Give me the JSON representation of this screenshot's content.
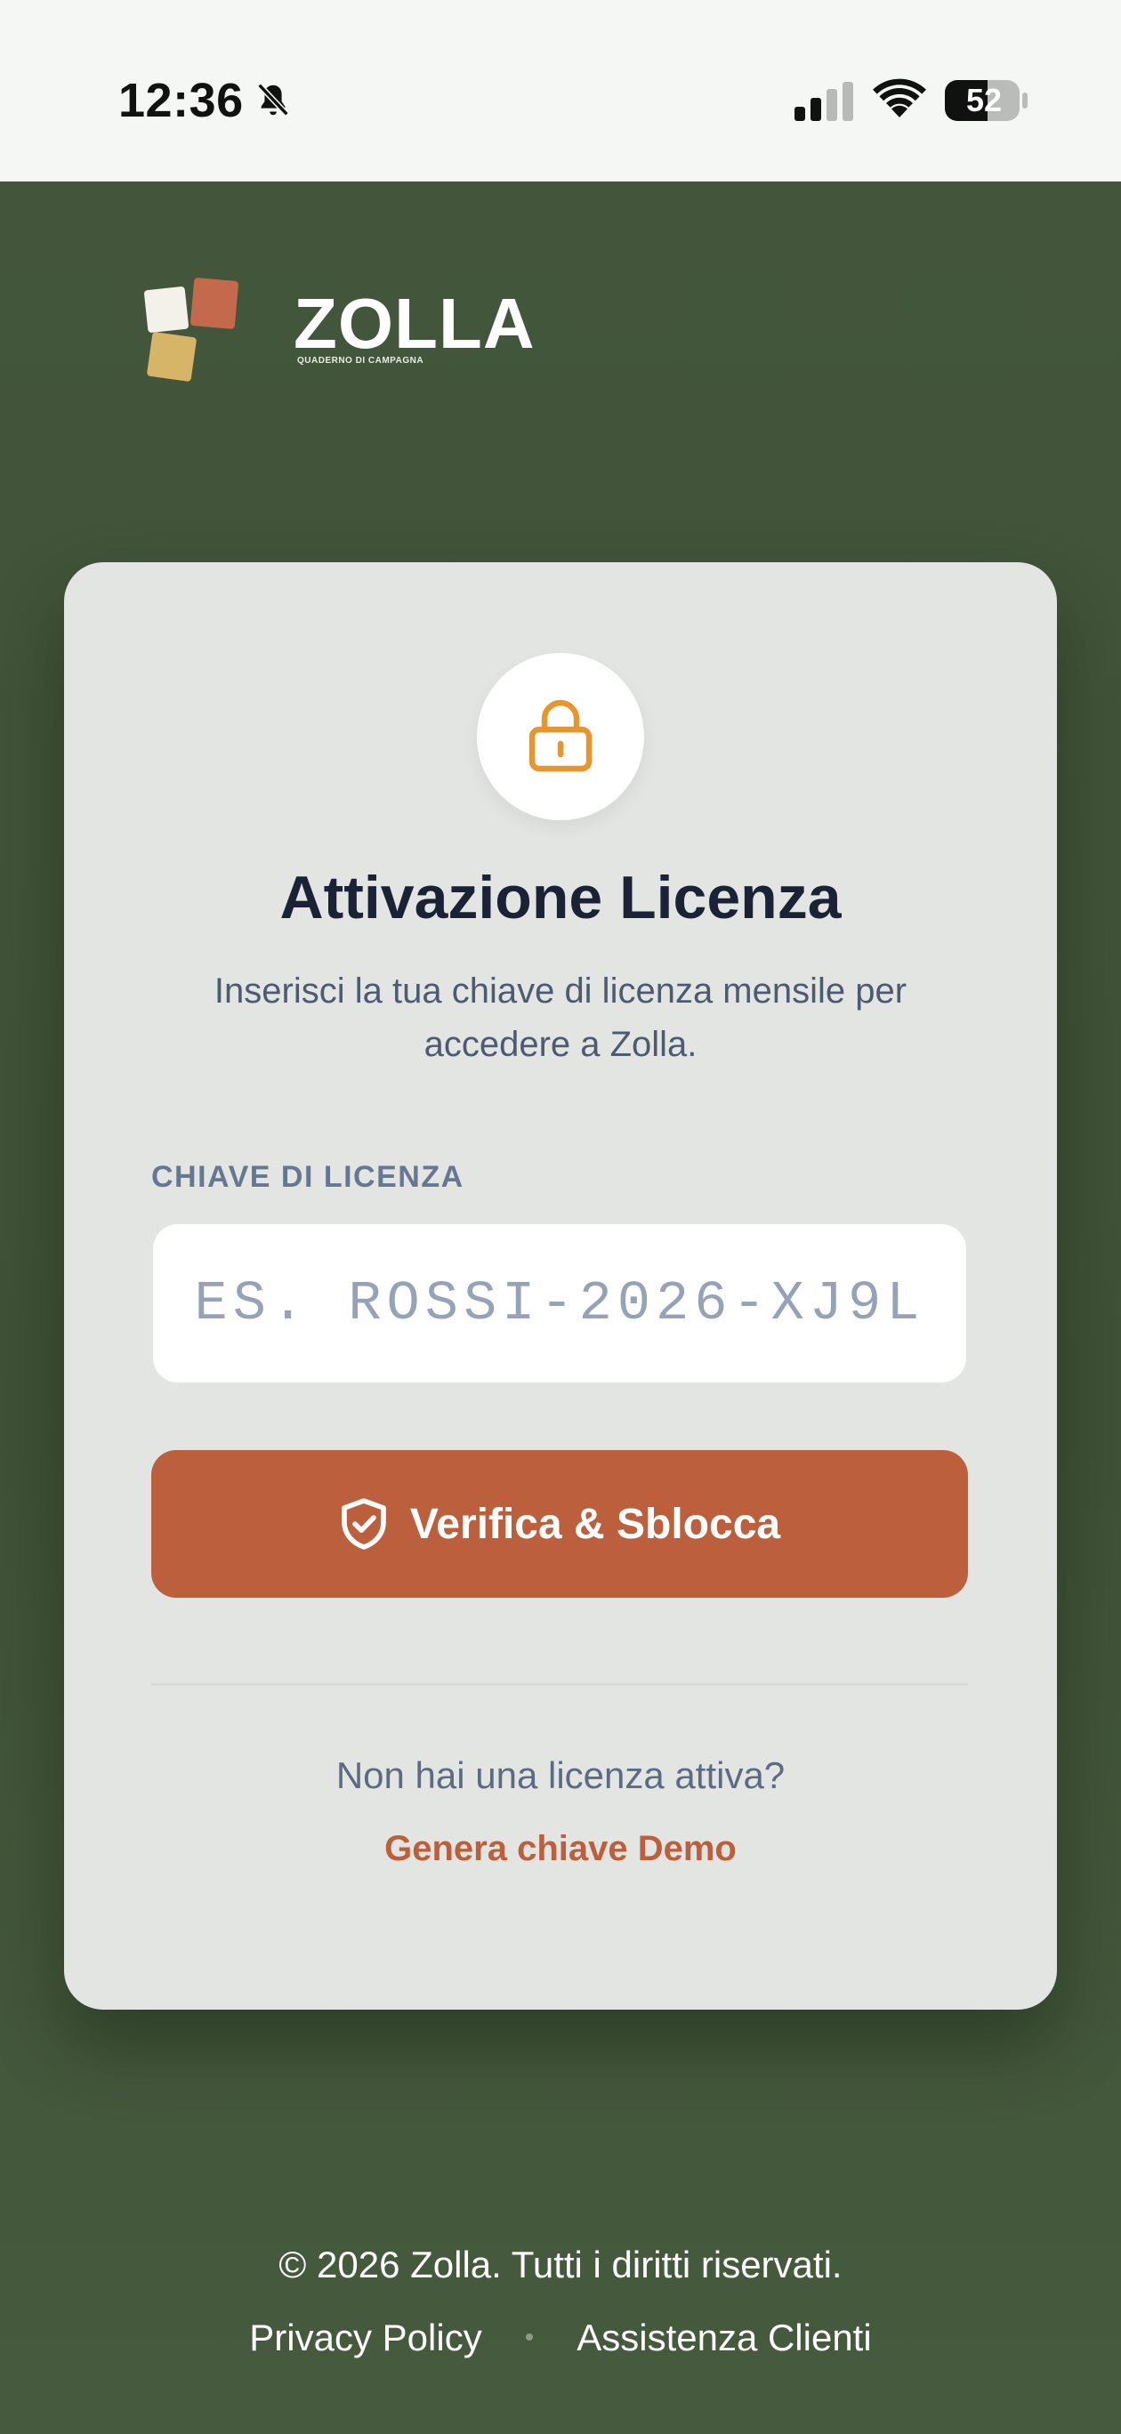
{
  "status_bar": {
    "time": "12:36",
    "battery_level": "52",
    "icons": [
      "bell-slash-icon",
      "cellular-signal-icon",
      "wifi-icon",
      "battery-icon"
    ]
  },
  "brand": {
    "name": "ZOLLA",
    "tagline": "QUADERNO DI CAMPAGNA",
    "colors": {
      "white": "#f4f1ea",
      "terracotta": "#c4694b",
      "sand": "#d6b468"
    }
  },
  "card": {
    "icon": "lock-icon",
    "title": "Attivazione Licenza",
    "subtitle": "Inserisci la tua chiave di licenza mensile per accedere a Zolla.",
    "field_label": "CHIAVE DI LICENZA",
    "input": {
      "value": "",
      "placeholder": "ES. ROSSI-2026-XJ9L"
    },
    "verify_button": {
      "icon": "shield-check-icon",
      "label": "Verifica & Sblocca"
    },
    "no_license_text": "Non hai una licenza attiva?",
    "demo_link": "Genera chiave Demo"
  },
  "footer": {
    "copyright": "© 2026 Zolla. Tutti i diritti riservati.",
    "separator": "•",
    "links": [
      "Privacy Policy",
      "Assistenza Clienti"
    ]
  },
  "colors": {
    "background": "#43563c",
    "card": "#e3e5e3",
    "accent": "#bb5f3c",
    "lock_icon": "#e8952e",
    "title": "#1c2236"
  }
}
